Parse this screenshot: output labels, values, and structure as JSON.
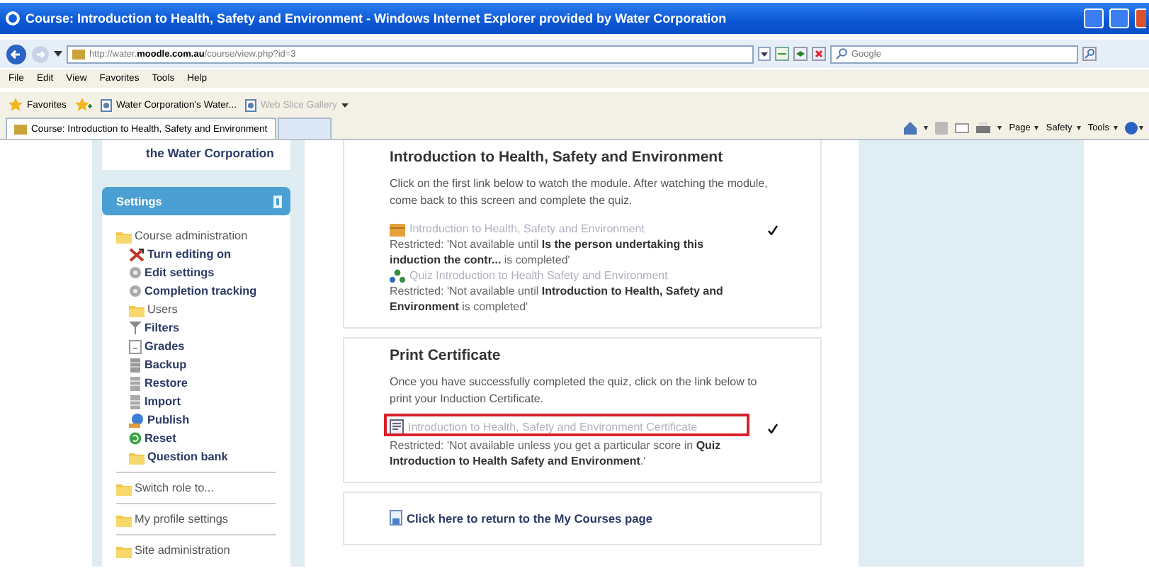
{
  "window": {
    "title": "Course: Introduction to Health, Safety and Environment - Windows Internet Explorer provided by Water Corporation"
  },
  "address_bar": {
    "url": "http://water.**moodle.com.au**/course/view.php?id=3"
  },
  "search": {
    "placeholder": "Google"
  },
  "menu": [
    "File",
    "Edit",
    "View",
    "Favorites",
    "Tools",
    "Help"
  ],
  "favorites_bar": {
    "label": "Favorites",
    "items": [
      {
        "label": "Water Corporation's Water...",
        "disabled": false
      },
      {
        "label": "Web Slice Gallery",
        "disabled": true
      }
    ]
  },
  "tabs": [
    {
      "label": "Course: Introduction to Health, Safety and Environment",
      "selected": true
    }
  ],
  "command_bar": [
    "Page",
    "Safety",
    "Tools"
  ],
  "sidebar": {
    "block_link": "the Water Corporation",
    "settings": {
      "title": "Settings",
      "items": [
        {
          "label": "Course administration",
          "kind": "branch",
          "children": [
            {
              "label": "Turn editing on",
              "kind": "editing"
            },
            {
              "label": "Edit settings",
              "kind": "settings"
            },
            {
              "label": "Completion tracking",
              "kind": "settings"
            },
            {
              "label": "Users",
              "kind": "branch"
            },
            {
              "label": "Filters",
              "kind": "filters"
            },
            {
              "label": "Grades",
              "kind": "grades"
            },
            {
              "label": "Backup",
              "kind": "backup"
            },
            {
              "label": "Restore",
              "kind": "restore"
            },
            {
              "label": "Import",
              "kind": "import"
            },
            {
              "label": "Publish",
              "kind": "publish"
            },
            {
              "label": "Reset",
              "kind": "reset"
            },
            {
              "label": "Question bank",
              "kind": "questions"
            }
          ]
        },
        {
          "label": "Switch role to...",
          "kind": "branch"
        },
        {
          "label": "My profile settings",
          "kind": "branch"
        },
        {
          "label": "Site administration",
          "kind": "branch"
        }
      ]
    }
  },
  "sections": [
    {
      "title": "Introduction to Health, Safety and Environment",
      "summary": "Click on the first link below to watch the module.  After watching the module, come back to this screen and complete the quiz.",
      "activities": [
        {
          "kind": "resource",
          "name": "Introduction to Health, Safety and Environment",
          "dimmed": true,
          "restriction": "Restricted: 'Not available until **Is the person undertaking this induction the contr...** is completed'",
          "completed": true,
          "highlighted": false
        },
        {
          "kind": "quiz",
          "name": "Quiz Introduction to Health Safety and Environment",
          "dimmed": true,
          "restriction": "Restricted: 'Not available until **Introduction to Health, Safety and Environment** is completed'",
          "completed": false,
          "highlighted": false
        }
      ]
    },
    {
      "title": "Print Certificate",
      "summary": "Once you have successfully completed the quiz, click on the link below to print your Induction Certificate.",
      "activities": [
        {
          "kind": "certificate",
          "name": "Introduction to Health, Safety and Environment Certificate",
          "dimmed": true,
          "restriction": "Restricted: 'Not available unless you get a particular score in **Quiz Introduction to Health Safety and Environment**.'",
          "completed": true,
          "highlighted": true
        }
      ]
    },
    {
      "activities": [
        {
          "kind": "page",
          "name": "Click here to return to the My Courses page",
          "dimmed": false,
          "completed": false,
          "highlighted": false
        }
      ]
    }
  ]
}
